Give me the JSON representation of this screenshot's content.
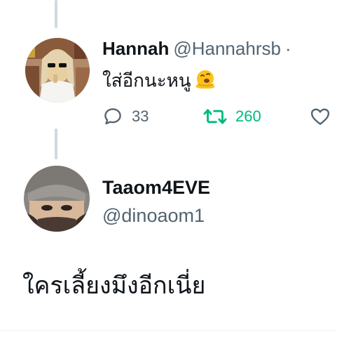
{
  "reply": {
    "name": "Hannah",
    "handle": "@Hannahrsb",
    "separator": "·",
    "text": "ใส่อีกนะหนู",
    "emoji_icon": "melting-face-icon",
    "actions": {
      "replies": "33",
      "retweets": "260",
      "comment_icon": "comment-icon",
      "retweet_icon": "retweet-icon",
      "like_icon": "heart-icon"
    }
  },
  "tweet": {
    "name": "Taaom4EVE",
    "handle": "@dinoaom1",
    "text": "ใครเลี้ยงมึงอีกเนี่ย"
  },
  "colors": {
    "text_primary": "#0f1419",
    "text_secondary": "#536471",
    "retweet_green": "#00ba7c",
    "thread_line": "#cfd9de"
  }
}
